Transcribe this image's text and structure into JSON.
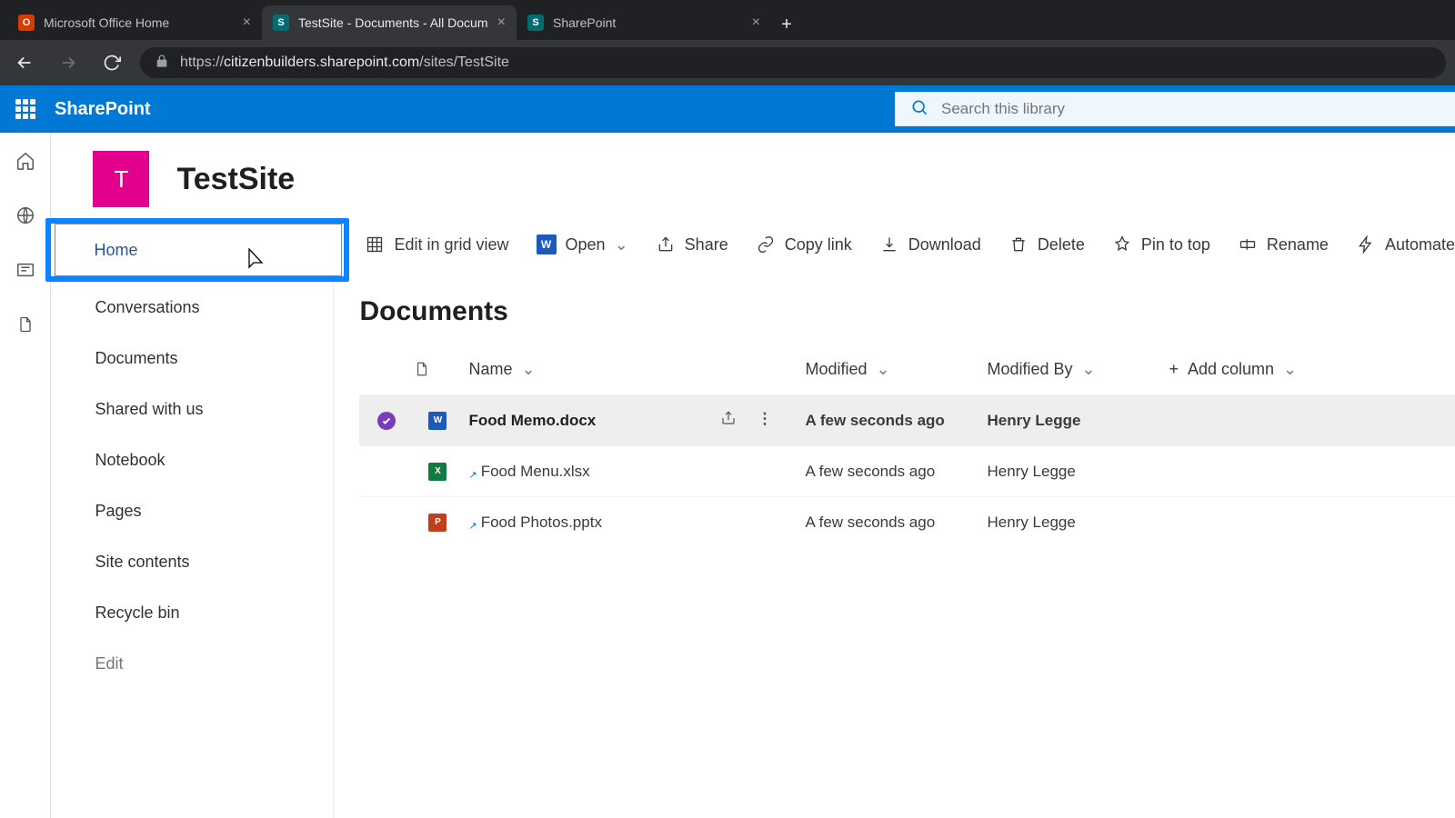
{
  "browser": {
    "tabs": [
      {
        "title": "Microsoft Office Home",
        "active": false,
        "fav": "O"
      },
      {
        "title": "TestSite - Documents - All Docum",
        "active": true,
        "fav": "S"
      },
      {
        "title": "SharePoint",
        "active": false,
        "fav": "S"
      }
    ],
    "url_prefix": "https://",
    "url_domain": "citizenbuilders.sharepoint.com",
    "url_path": "/sites/TestSite"
  },
  "suite": {
    "brand": "SharePoint",
    "search_placeholder": "Search this library"
  },
  "site": {
    "logo_letter": "T",
    "title": "TestSite"
  },
  "leftnav": {
    "items": [
      {
        "label": "Home",
        "key": "home"
      },
      {
        "label": "Conversations",
        "key": "conversations"
      },
      {
        "label": "Documents",
        "key": "documents"
      },
      {
        "label": "Shared with us",
        "key": "shared"
      },
      {
        "label": "Notebook",
        "key": "notebook"
      },
      {
        "label": "Pages",
        "key": "pages"
      },
      {
        "label": "Site contents",
        "key": "contents"
      },
      {
        "label": "Recycle bin",
        "key": "recycle"
      },
      {
        "label": "Edit",
        "key": "edit"
      }
    ]
  },
  "commands": {
    "edit_grid": "Edit in grid view",
    "open": "Open",
    "share": "Share",
    "copy_link": "Copy link",
    "download": "Download",
    "delete": "Delete",
    "pin": "Pin to top",
    "rename": "Rename",
    "automate": "Automate"
  },
  "library": {
    "title": "Documents",
    "columns": {
      "name": "Name",
      "modified": "Modified",
      "modified_by": "Modified By",
      "add": "Add column"
    },
    "rows": [
      {
        "name": "Food Memo.docx",
        "type": "word",
        "modified": "A few seconds ago",
        "modified_by": "Henry Legge",
        "selected": true,
        "new": false
      },
      {
        "name": "Food Menu.xlsx",
        "type": "xls",
        "modified": "A few seconds ago",
        "modified_by": "Henry Legge",
        "selected": false,
        "new": true
      },
      {
        "name": "Food Photos.pptx",
        "type": "ppt",
        "modified": "A few seconds ago",
        "modified_by": "Henry Legge",
        "selected": false,
        "new": true
      }
    ]
  }
}
